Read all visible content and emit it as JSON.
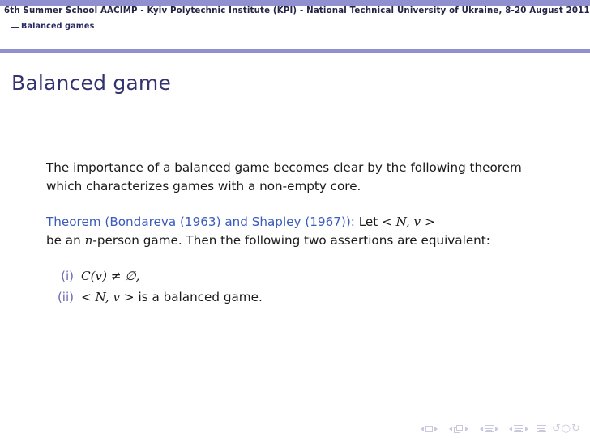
{
  "header": {
    "title": "6th Summer School AACIMP - Kyiv Polytechnic Institute (KPI) - National Technical University of Ukraine, 8-20 August 2011",
    "breadcrumb": "Balanced games",
    "breadcrumb_glyph": "corner-branch-icon",
    "bar_color": "#9090d0",
    "rule_color": "#9090d0",
    "title_color": "#222244"
  },
  "slide": {
    "frame_title": "Balanced game",
    "frame_title_color": "#33336e",
    "paragraph_1": "The importance of a balanced game becomes clear by the following theorem which characterizes games with a non-empty core.",
    "theorem": {
      "label": "Theorem (Bondareva (1963) and Shapley (1967)):",
      "label_color": "#3b5bbd",
      "statement_lead": "Let",
      "statement_tuple": "< N, v >",
      "statement_rest_1": "be an",
      "statement_var": "n",
      "statement_rest_2": "-person game. Then the following two assertions are equivalent:"
    },
    "enumerate": [
      {
        "marker": "(i)",
        "math_fn": "C",
        "math_arg": "(v)",
        "math_rel": "≠",
        "math_set": "∅",
        "math_tail": ",",
        "text": "C(v) ≠ ∅,"
      },
      {
        "marker": "(ii)",
        "math_tuple": "< N, v >",
        "text_tail": "is a balanced game.",
        "text": "< N, v > is a balanced game."
      }
    ],
    "marker_color": "#6a6ab0"
  },
  "navigation": {
    "color": "#c9c9dd",
    "groups": [
      {
        "name": "slide-navigation",
        "prev": "◀",
        "icon": "slide-icon",
        "next": "▶"
      },
      {
        "name": "frame-navigation",
        "prev": "◀",
        "icon": "frame-icon",
        "next": "▶"
      },
      {
        "name": "subsection-navigation",
        "prev": "◀",
        "icon": "subsection-icon",
        "next": "▶"
      },
      {
        "name": "section-navigation",
        "prev": "◀",
        "icon": "section-icon",
        "next": "▶"
      }
    ],
    "presentation_icon": "presentation-icon",
    "back_icon": "↺",
    "search_icon": "○",
    "forward_icon": "↻"
  }
}
